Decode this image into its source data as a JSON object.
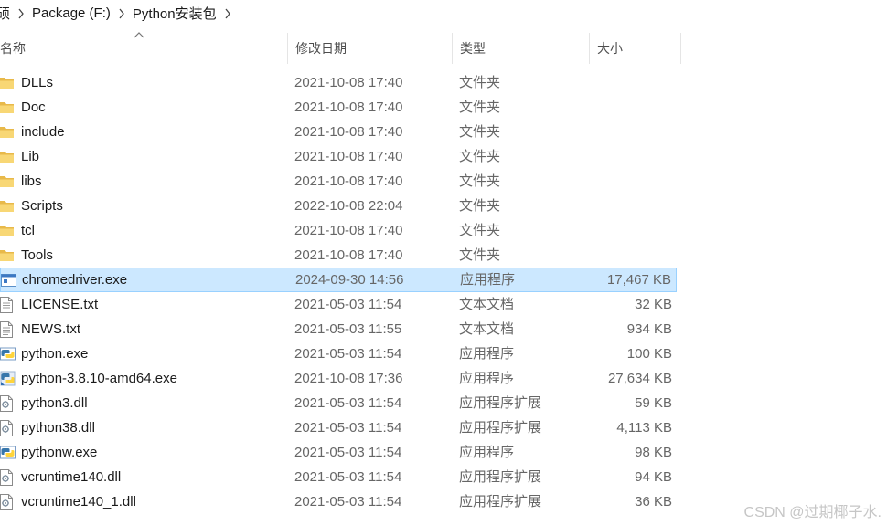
{
  "breadcrumb": {
    "items": [
      "硕",
      "Package (F:)",
      "Python安装包"
    ]
  },
  "columns": {
    "name": "名称",
    "date": "修改日期",
    "type": "类型",
    "size": "大小"
  },
  "files": [
    {
      "name": "DLLs",
      "date": "2021-10-08 17:40",
      "type": "文件夹",
      "size": "",
      "icon": "folder-icon"
    },
    {
      "name": "Doc",
      "date": "2021-10-08 17:40",
      "type": "文件夹",
      "size": "",
      "icon": "folder-icon"
    },
    {
      "name": "include",
      "date": "2021-10-08 17:40",
      "type": "文件夹",
      "size": "",
      "icon": "folder-icon"
    },
    {
      "name": "Lib",
      "date": "2021-10-08 17:40",
      "type": "文件夹",
      "size": "",
      "icon": "folder-icon"
    },
    {
      "name": "libs",
      "date": "2021-10-08 17:40",
      "type": "文件夹",
      "size": "",
      "icon": "folder-icon"
    },
    {
      "name": "Scripts",
      "date": "2022-10-08 22:04",
      "type": "文件夹",
      "size": "",
      "icon": "folder-icon"
    },
    {
      "name": "tcl",
      "date": "2021-10-08 17:40",
      "type": "文件夹",
      "size": "",
      "icon": "folder-icon"
    },
    {
      "name": "Tools",
      "date": "2021-10-08 17:40",
      "type": "文件夹",
      "size": "",
      "icon": "folder-icon"
    },
    {
      "name": "chromedriver.exe",
      "date": "2024-09-30 14:56",
      "type": "应用程序",
      "size": "17,467 KB",
      "icon": "application-icon",
      "selected": true
    },
    {
      "name": "LICENSE.txt",
      "date": "2021-05-03 11:54",
      "type": "文本文档",
      "size": "32 KB",
      "icon": "text-file-icon"
    },
    {
      "name": "NEWS.txt",
      "date": "2021-05-03 11:55",
      "type": "文本文档",
      "size": "934 KB",
      "icon": "text-file-icon"
    },
    {
      "name": "python.exe",
      "date": "2021-05-03 11:54",
      "type": "应用程序",
      "size": "100 KB",
      "icon": "python-icon"
    },
    {
      "name": "python-3.8.10-amd64.exe",
      "date": "2021-10-08 17:36",
      "type": "应用程序",
      "size": "27,634 KB",
      "icon": "python-installer-icon"
    },
    {
      "name": "python3.dll",
      "date": "2021-05-03 11:54",
      "type": "应用程序扩展",
      "size": "59 KB",
      "icon": "dll-icon"
    },
    {
      "name": "python38.dll",
      "date": "2021-05-03 11:54",
      "type": "应用程序扩展",
      "size": "4,113 KB",
      "icon": "dll-icon"
    },
    {
      "name": "pythonw.exe",
      "date": "2021-05-03 11:54",
      "type": "应用程序",
      "size": "98 KB",
      "icon": "python-icon"
    },
    {
      "name": "vcruntime140.dll",
      "date": "2021-05-03 11:54",
      "type": "应用程序扩展",
      "size": "94 KB",
      "icon": "dll-icon"
    },
    {
      "name": "vcruntime140_1.dll",
      "date": "2021-05-03 11:54",
      "type": "应用程序扩展",
      "size": "36 KB",
      "icon": "dll-icon"
    }
  ],
  "watermark": "CSDN @过期椰子水.",
  "colors": {
    "selection_bg": "#cce8ff",
    "selection_border": "#99d1ff",
    "folder": "#f8d775",
    "folder_dark": "#e8b94a",
    "muted_text": "#666666"
  }
}
